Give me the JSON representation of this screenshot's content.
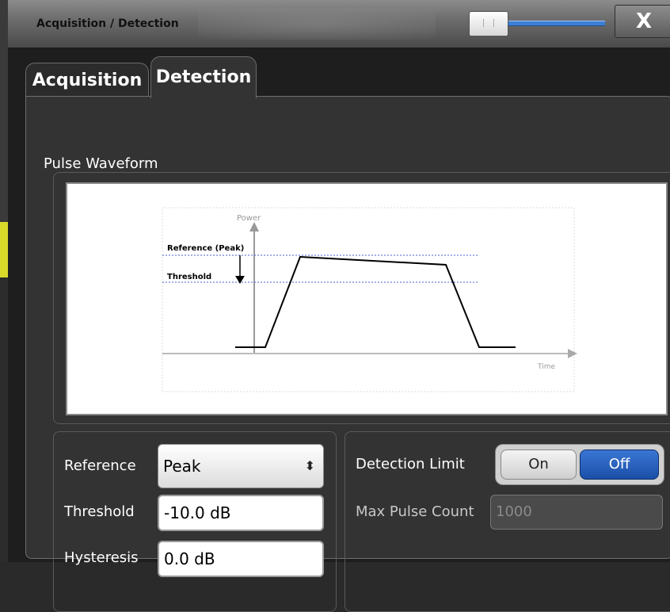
{
  "window": {
    "title": "Acquisition / Detection",
    "close_glyph": "X"
  },
  "tabs": [
    {
      "label": "Acquisition",
      "active": false
    },
    {
      "label": "Detection",
      "active": true
    }
  ],
  "pulse_waveform": {
    "title": "Pulse Waveform",
    "diagram": {
      "y_axis_label": "Power",
      "x_axis_label": "Time",
      "reference_label": "Reference (Peak)",
      "threshold_label": "Threshold"
    }
  },
  "settings": {
    "reference_label": "Reference",
    "reference_value": "Peak",
    "threshold_label": "Threshold",
    "threshold_value": "-10.0 dB",
    "hysteresis_label": "Hysteresis",
    "hysteresis_value": "0.0 dB"
  },
  "detection": {
    "limit_label": "Detection Limit",
    "on_label": "On",
    "off_label": "Off",
    "selected": "Off",
    "max_pulse_label": "Max Pulse Count",
    "max_pulse_value": "1000"
  },
  "colors": {
    "accent": "#1b4fa8",
    "slider": "#3e7fd6",
    "threshold_line": "#4a5fd0"
  }
}
